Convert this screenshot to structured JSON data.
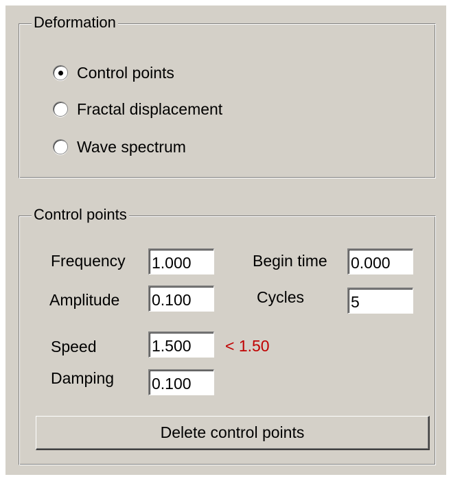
{
  "deformation": {
    "title": "Deformation",
    "options": [
      {
        "label": "Control points",
        "checked": true
      },
      {
        "label": "Fractal displacement",
        "checked": false
      },
      {
        "label": "Wave spectrum",
        "checked": false
      }
    ]
  },
  "control_points": {
    "title": "Control points",
    "frequency": {
      "label": "Frequency",
      "value": "1.000"
    },
    "amplitude": {
      "label": "Amplitude",
      "value": "0.100"
    },
    "speed": {
      "label": "Speed",
      "value": "1.500",
      "hint": "< 1.50"
    },
    "damping": {
      "label": "Damping",
      "value": "0.100"
    },
    "begin_time": {
      "label": "Begin time",
      "value": "0.000"
    },
    "cycles": {
      "label": "Cycles",
      "value": "5"
    },
    "delete_button": "Delete control points",
    "hint_color": "#c00000"
  }
}
